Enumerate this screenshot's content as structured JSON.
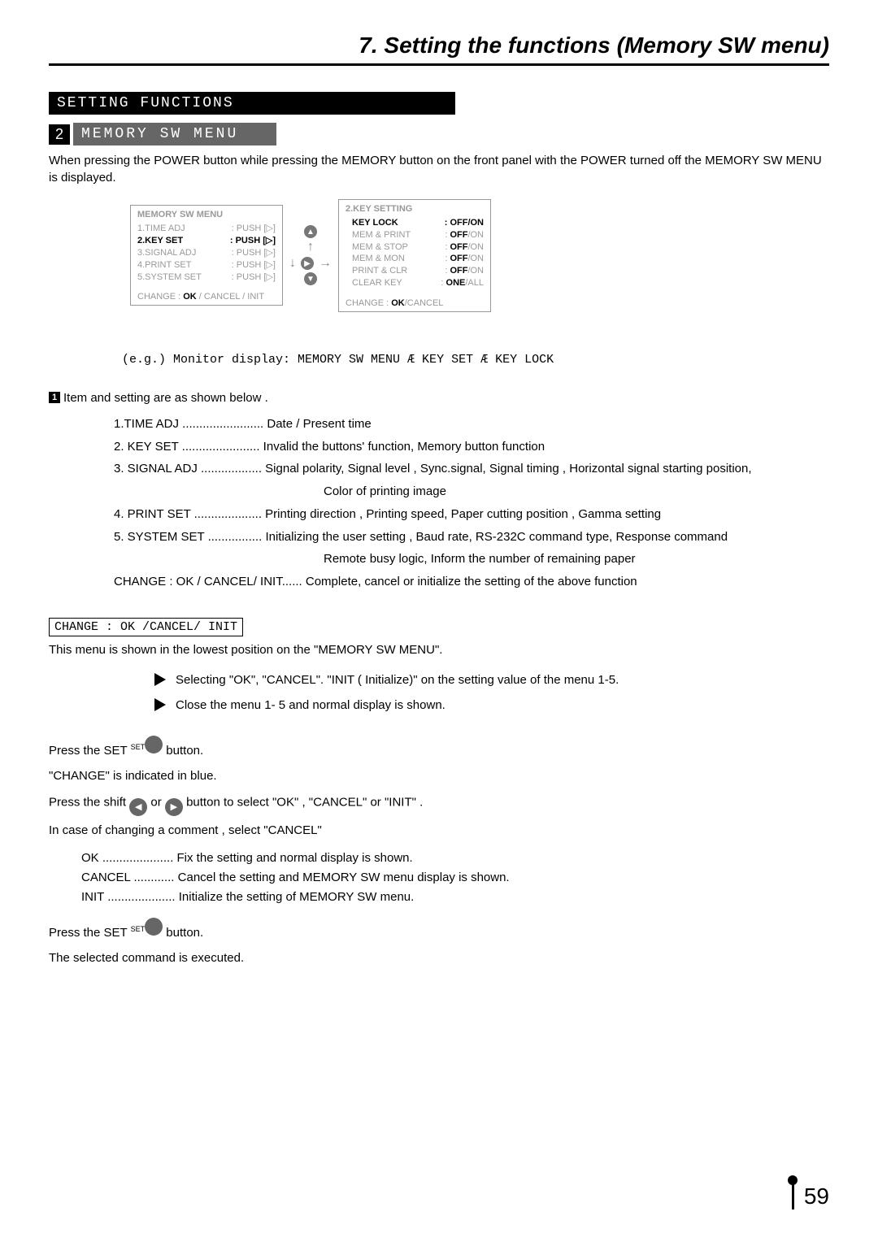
{
  "chapter_title": "7. Setting the functions (Memory SW menu)",
  "heading_main": "SETTING  FUNCTIONS",
  "heading_sub_num": "2",
  "heading_sub": "MEMORY SW   MENU",
  "intro": "When pressing the POWER button while pressing the MEMORY button on the front panel with the POWER  turned off  the MEMORY SW MENU is displayed.",
  "panel_left": {
    "title": "MEMORY SW MENU",
    "rows": [
      {
        "label": "1.TIME ADJ",
        "val": "PUSH [▷]",
        "active": false
      },
      {
        "label": "2.KEY SET",
        "val": "PUSH [▷]",
        "active": true
      },
      {
        "label": "3.SIGNAL ADJ",
        "val": "PUSH [▷]",
        "active": false
      },
      {
        "label": "4.PRINT SET",
        "val": "PUSH [▷]",
        "active": false
      },
      {
        "label": "5.SYSTEM SET",
        "val": "PUSH [▷]",
        "active": false
      }
    ],
    "footer_prefix": "CHANGE : ",
    "footer_bold": "OK",
    "footer_suffix": " / CANCEL / INIT"
  },
  "panel_right": {
    "title": "2.KEY SETTING",
    "rows": [
      {
        "label": "KEY LOCK",
        "off": "OFF",
        "on": "ON",
        "active": true
      },
      {
        "label": "MEM & PRINT",
        "off": "OFF",
        "on": "ON",
        "active": false
      },
      {
        "label": "MEM & STOP",
        "off": "OFF",
        "on": "ON",
        "active": false
      },
      {
        "label": "MEM & MON",
        "off": "OFF",
        "on": "ON",
        "active": false
      },
      {
        "label": "PRINT & CLR",
        "off": "OFF",
        "on": "ON",
        "active": false
      },
      {
        "label": "CLEAR KEY",
        "off": "ONE",
        "on": "ALL",
        "active": false
      }
    ],
    "footer_prefix": "CHANGE : ",
    "footer_bold": "OK",
    "footer_suffix": "/CANCEL"
  },
  "example_line": "(e.g.) Monitor display: MEMORY SW  MENU Æ    KEY SET Æ   KEY LOCK",
  "items_lead": "Item and setting are as shown below .",
  "items": [
    {
      "label": "1.TIME ADJ ........................",
      "desc": " Date / Present time"
    },
    {
      "label": "2. KEY SET .......................",
      "desc": " Invalid the buttons' function, Memory button function"
    },
    {
      "label": "3. SIGNAL  ADJ ..................",
      "desc": " Signal polarity, Signal level , Sync.signal, Signal timing , Horizontal signal starting position,"
    },
    {
      "label": "",
      "desc": "Color of printing image",
      "sub": true
    },
    {
      "label": "4. PRINT  SET ....................",
      "desc": " Printing direction , Printing speed, Paper cutting position , Gamma setting"
    },
    {
      "label": "5. SYSTEM  SET ................",
      "desc": " Initializing the user setting , Baud rate, RS-232C command type, Response command"
    },
    {
      "label": "",
      "desc": "Remote busy logic, Inform the number of remaining paper",
      "sub": true
    },
    {
      "label": "CHANGE : OK / CANCEL/ INIT......",
      "desc": "  Complete, cancel or initialize the setting of the above function"
    }
  ],
  "box_label": "CHANGE : OK /CANCEL/ INIT",
  "box_desc": "This menu is shown in the lowest position on the \"MEMORY SW MENU\".",
  "bullet1": "Selecting \"OK\", \"CANCEL\". \"INIT ( Initialize)\" on the setting value of the menu 1-5.",
  "bullet2": "Close the menu 1- 5 and normal display is shown.",
  "set_label": "SET",
  "press_set_a": "Press the SET",
  "press_set_b": "button.",
  "change_blue": "\"CHANGE\"  is indicated in blue.",
  "shift_a": "Press the shift",
  "shift_b": "or",
  "shift_c": "button to select \"OK\" ,  \"CANCEL\" or \"INIT\" .",
  "cancel_note": "In case of changing a comment , select \"CANCEL\"",
  "ok_line": "OK .....................  Fix the setting and normal display is shown.",
  "cancel_line": "CANCEL ............  Cancel the setting and MEMORY SW menu display is shown.",
  "init_line": "INIT ....................  Initialize the setting of MEMORY SW menu.",
  "executed": "The selected command is executed.",
  "page_number": "59"
}
